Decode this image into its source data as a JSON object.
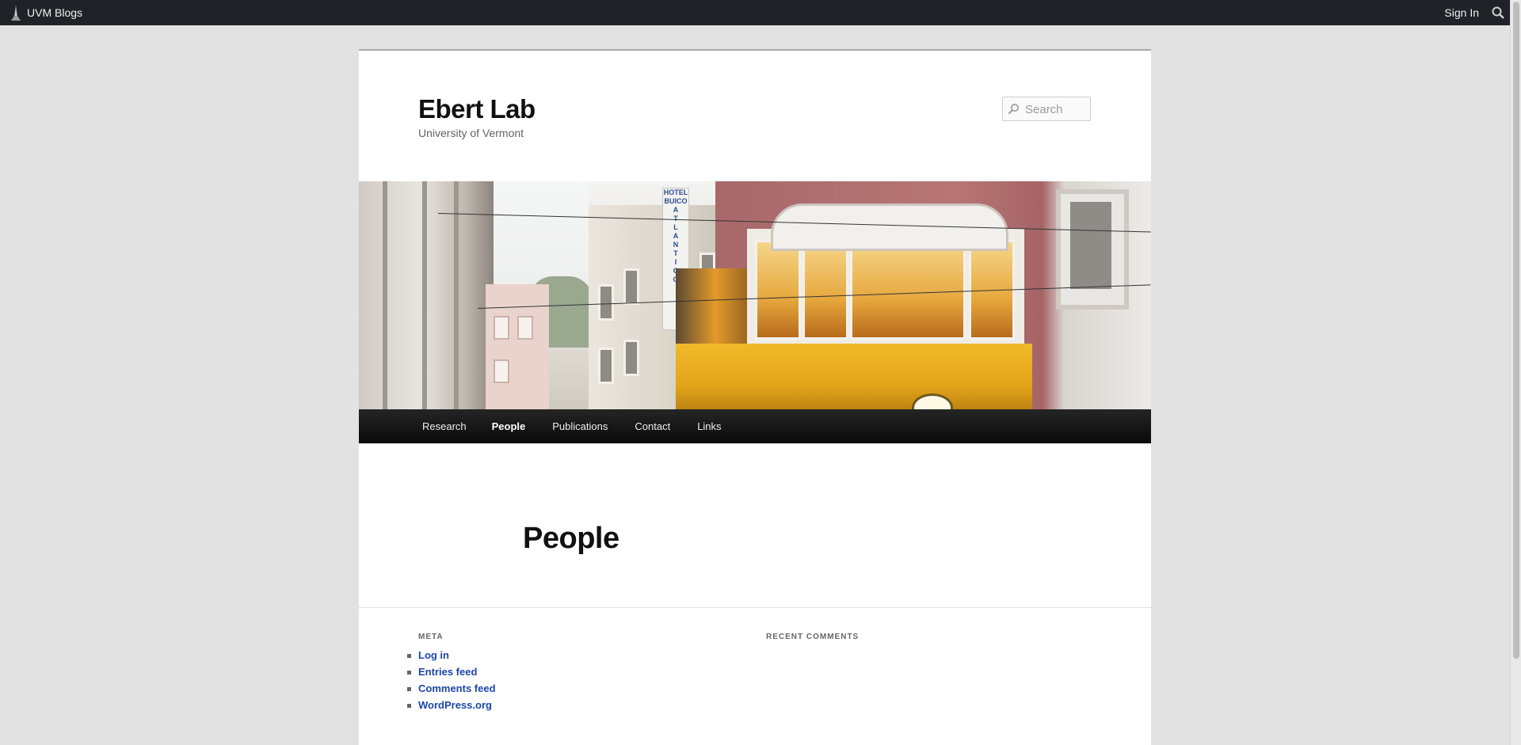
{
  "adminbar": {
    "brand_label": "UVM Blogs",
    "signin_label": "Sign In",
    "search_icon": "search-icon",
    "background": "#1f2327"
  },
  "site": {
    "title": "Ebert Lab",
    "description": "University of Vermont",
    "search_placeholder": "Search"
  },
  "header_image": {
    "sign_letters": [
      "HOTEL",
      "BUICO",
      "A",
      "T",
      "L",
      "A",
      "N",
      "T",
      "I",
      "C",
      "O"
    ]
  },
  "nav": {
    "items": [
      {
        "label": "Research"
      },
      {
        "label": "People"
      },
      {
        "label": "Publications"
      },
      {
        "label": "Contact"
      },
      {
        "label": "Links"
      }
    ],
    "current": "People"
  },
  "entry": {
    "title": "People"
  },
  "widgets": {
    "meta": {
      "title": "Meta",
      "links": [
        "Log in",
        "Entries feed",
        "Comments feed",
        "WordPress.org"
      ]
    },
    "recent_comments": {
      "title": "Recent Comments"
    }
  },
  "colors": {
    "link": "#1b46a9",
    "page_bg": "#e2e2e2",
    "nav_bg": "#111111"
  }
}
